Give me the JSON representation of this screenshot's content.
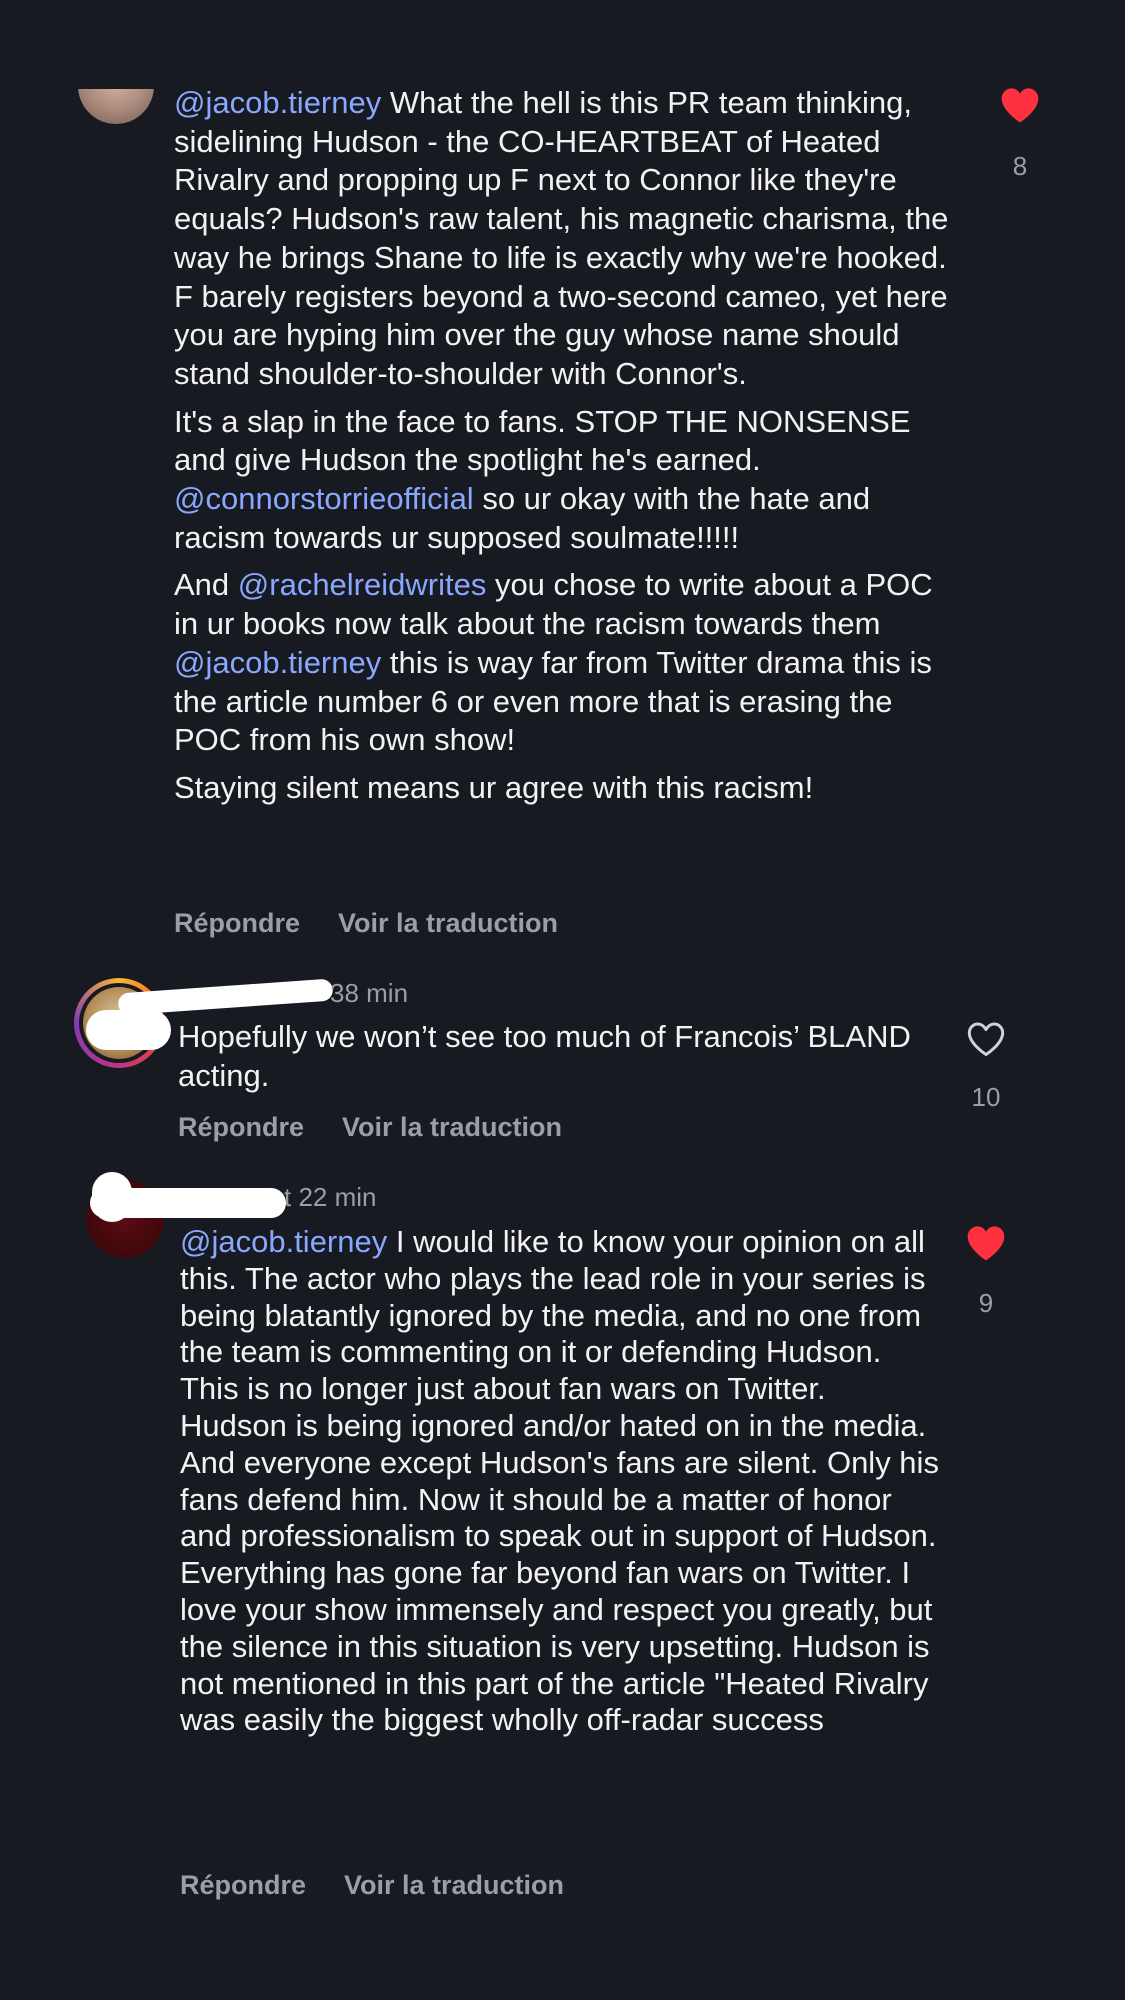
{
  "comments": [
    {
      "username": "",
      "time": "",
      "liked": true,
      "like_count": "8",
      "paragraphs": [
        [
          {
            "type": "mention",
            "text": "@jacob.tierney"
          },
          {
            "type": "text",
            "text": " What the hell is this PR team thinking, sidelining Hudson - the CO-HEARTBEAT of Heated Rivalry and propping up F next to Connor like they're equals? Hudson's raw talent, his magnetic charisma, the way he brings Shane to life is exactly why we're hooked. F barely registers beyond a two-second cameo, yet here you are hyping him over the guy whose name should stand shoulder-to-shoulder with Connor's."
          }
        ],
        [
          {
            "type": "text",
            "text": "It's a slap in the face to fans. STOP THE NONSENSE and give Hudson the spotlight he's earned. "
          },
          {
            "type": "mention",
            "text": "@connorstorrieofficial"
          },
          {
            "type": "text",
            "text": " so ur okay with the hate and racism towards ur supposed soulmate!!!!!"
          }
        ],
        [
          {
            "type": "text",
            "text": "And "
          },
          {
            "type": "mention",
            "text": "@rachelreidwrites"
          },
          {
            "type": "text",
            "text": " you chose to write about a POC in ur books now talk about the racism towards them "
          },
          {
            "type": "mention",
            "text": "@jacob.tierney"
          },
          {
            "type": "text",
            "text": " this is way far from Twitter drama this is the article number 6 or even more that is erasing the POC from his own show!"
          }
        ],
        [
          {
            "type": "text",
            "text": "Staying silent means ur agree with this racism!"
          }
        ]
      ],
      "reply_label": "Répondre",
      "translate_label": "Voir la traduction"
    },
    {
      "username": "",
      "time": "38 min",
      "liked": false,
      "like_count": "10",
      "paragraphs": [
        [
          {
            "type": "text",
            "text": "Hopefully we won’t see too much of Francois’ BLAND acting."
          }
        ]
      ],
      "reply_label": "Répondre",
      "translate_label": "Voir la traduction"
    },
    {
      "username": "t",
      "time": "22 min",
      "liked": true,
      "like_count": "9",
      "paragraphs": [
        [
          {
            "type": "mention",
            "text": "@jacob.tierney"
          },
          {
            "type": "text",
            "text": " I would like to know your opinion on all this. The actor who plays the lead role in your series is being blatantly ignored by the media, and no one from the team is commenting on it or defending Hudson. This is no longer just about fan wars on Twitter. Hudson is being ignored and/or hated on in the media. And everyone except Hudson's fans are silent. Only his fans defend him. Now it should be a matter of honor and professionalism to speak out in support of Hudson. Everything has gone far beyond fan wars on Twitter. I love your show immensely and respect you greatly, but the silence in this situation is very upsetting. Hudson is not mentioned in this part of the article \"Heated Rivalry was easily the biggest wholly off-radar success"
          }
        ]
      ],
      "reply_label": "Répondre",
      "translate_label": "Voir la traduction"
    }
  ],
  "colors": {
    "background": "#171a20",
    "text": "#f2f2f2",
    "mention": "#8aa7ff",
    "secondary": "#9a9ea6",
    "heart_filled": "#ff3040"
  },
  "icons": {
    "like_filled": "heart-filled-icon",
    "like_outline": "heart-outline-icon"
  }
}
